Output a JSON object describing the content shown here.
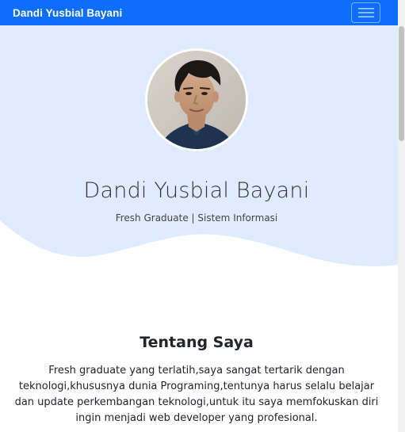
{
  "navbar": {
    "brand": "Dandi Yusbial Bayani",
    "toggler_icon": "hamburger-icon"
  },
  "hero": {
    "name": "Dandi Yusbial Bayani",
    "subtitle": "Fresh Graduate | Sistem Informasi",
    "avatar": "profile-photo"
  },
  "about": {
    "title": "Tentang Saya",
    "text": "Fresh graduate yang terlatih,saya sangat tertarik dengan teknologi,khususnya dunia Programing,tentunya harus selalu belajar dan update perkembangan teknologi,untuk itu saya memfokuskan diri ingin menjadi web developer yang profesional."
  },
  "colors": {
    "navbar": "#0d6efd",
    "hero_background": "#e1ebff",
    "text": "#212529"
  }
}
